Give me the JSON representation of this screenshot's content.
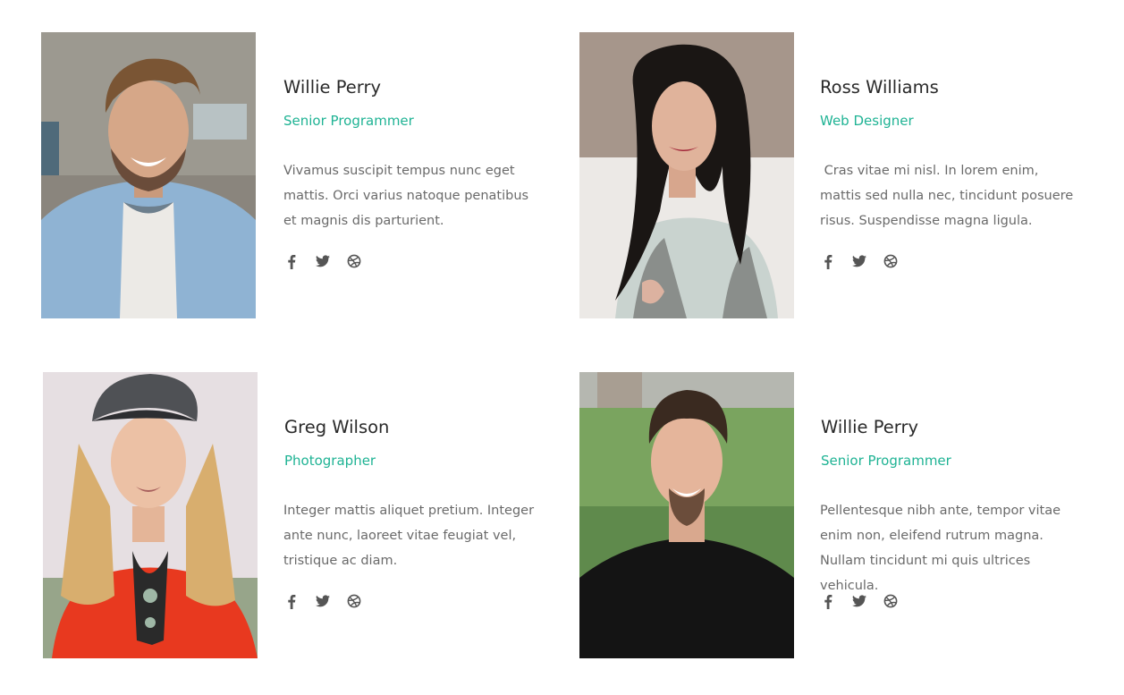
{
  "team": [
    {
      "name": "Willie Perry",
      "role": "Senior Programmer",
      "bio": "Vivamus suscipit tempus nunc eget mattis. Orci varius natoque penatibus et magnis dis parturient.",
      "social": [
        "facebook-icon",
        "twitter-icon",
        "dribbble-icon"
      ]
    },
    {
      "name": "Ross Williams",
      "role": "Web Designer",
      "bio": " Cras vitae mi nisl. In lorem enim, mattis sed nulla nec, tincidunt posuere risus. Suspendisse magna ligula.",
      "social": [
        "facebook-icon",
        "twitter-icon",
        "dribbble-icon"
      ]
    },
    {
      "name": "Greg Wilson",
      "role": "Photographer",
      "bio": "Integer mattis aliquet pretium. Integer ante nunc, laoreet vitae feugiat vel, tristique ac diam.",
      "social": [
        "facebook-icon",
        "twitter-icon",
        "dribbble-icon"
      ]
    },
    {
      "name": "Willie Perry",
      "role": "Senior Programmer",
      "bio": "Pellentesque nibh ante, tempor vitae enim non, eleifend rutrum magna. Nullam tincidunt mi quis ultrices vehicula.",
      "social": [
        "facebook-icon",
        "twitter-icon",
        "dribbble-icon"
      ]
    }
  ],
  "colors": {
    "accent": "#1fb394",
    "name": "#2a2a2a",
    "text": "#6a6a6a",
    "icon": "#555555"
  }
}
